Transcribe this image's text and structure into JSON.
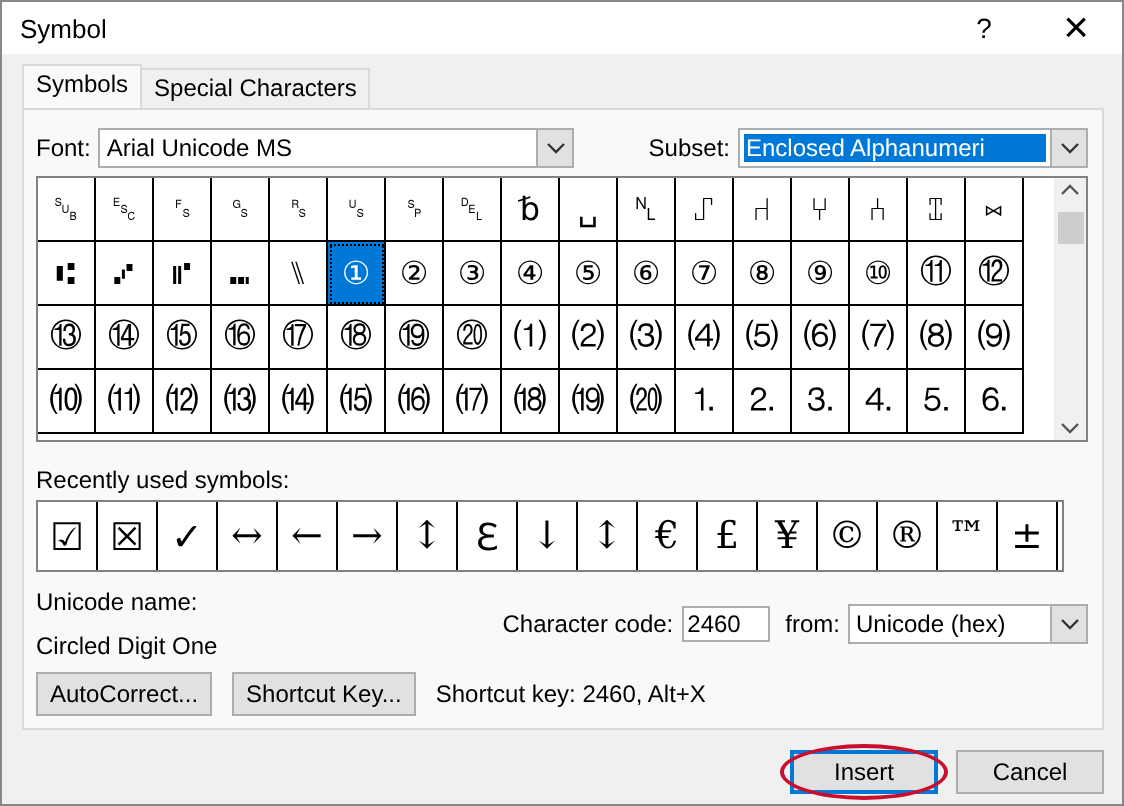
{
  "window": {
    "title": "Symbol",
    "help": "?",
    "close": "×"
  },
  "tabs": [
    {
      "label": "Symbols",
      "selected": true
    },
    {
      "label": "Special Characters",
      "selected": false
    }
  ],
  "font": {
    "label": "Font:",
    "value": "Arial Unicode MS"
  },
  "subset": {
    "label": "Subset:",
    "value": "Enclosed Alphanumeri"
  },
  "symbols": [
    [
      {
        "symbol": "␚",
        "selected": false
      },
      {
        "symbol": "␛",
        "selected": false
      },
      {
        "symbol": "␜",
        "selected": false
      },
      {
        "symbol": "␝",
        "selected": false
      },
      {
        "symbol": "␞",
        "selected": false
      },
      {
        "symbol": "␟",
        "selected": false
      },
      {
        "symbol": "␠",
        "selected": false
      },
      {
        "symbol": "␡",
        "selected": false
      },
      {
        "symbol": "␢",
        "selected": false
      },
      {
        "symbol": "␣",
        "selected": false
      },
      {
        "symbol": "␤",
        "selected": false
      },
      {
        "symbol": "⑀",
        "selected": false
      },
      {
        "symbol": "⑁",
        "selected": false
      },
      {
        "symbol": "⑂",
        "selected": false
      },
      {
        "symbol": "⑃",
        "selected": false
      },
      {
        "symbol": "⑄",
        "selected": false
      },
      {
        "symbol": "⑅",
        "selected": false
      }
    ],
    [
      {
        "symbol": "⑆",
        "selected": false
      },
      {
        "symbol": "⑇",
        "selected": false
      },
      {
        "symbol": "⑈",
        "selected": false
      },
      {
        "symbol": "⑉",
        "selected": false
      },
      {
        "symbol": "⑊",
        "selected": false
      },
      {
        "symbol": "①",
        "selected": true
      },
      {
        "symbol": "②",
        "selected": false
      },
      {
        "symbol": "③",
        "selected": false
      },
      {
        "symbol": "④",
        "selected": false
      },
      {
        "symbol": "⑤",
        "selected": false
      },
      {
        "symbol": "⑥",
        "selected": false
      },
      {
        "symbol": "⑦",
        "selected": false
      },
      {
        "symbol": "⑧",
        "selected": false
      },
      {
        "symbol": "⑨",
        "selected": false
      },
      {
        "symbol": "⑩",
        "selected": false
      },
      {
        "symbol": "⑪",
        "selected": false
      },
      {
        "symbol": "⑫",
        "selected": false
      }
    ],
    [
      {
        "symbol": "⑬",
        "selected": false
      },
      {
        "symbol": "⑭",
        "selected": false
      },
      {
        "symbol": "⑮",
        "selected": false
      },
      {
        "symbol": "⑯",
        "selected": false
      },
      {
        "symbol": "⑰",
        "selected": false
      },
      {
        "symbol": "⑱",
        "selected": false
      },
      {
        "symbol": "⑲",
        "selected": false
      },
      {
        "symbol": "⑳",
        "selected": false
      },
      {
        "symbol": "⑴",
        "selected": false
      },
      {
        "symbol": "⑵",
        "selected": false
      },
      {
        "symbol": "⑶",
        "selected": false
      },
      {
        "symbol": "⑷",
        "selected": false
      },
      {
        "symbol": "⑸",
        "selected": false
      },
      {
        "symbol": "⑹",
        "selected": false
      },
      {
        "symbol": "⑺",
        "selected": false
      },
      {
        "symbol": "⑻",
        "selected": false
      },
      {
        "symbol": "⑼",
        "selected": false
      }
    ],
    [
      {
        "symbol": "⑽",
        "selected": false
      },
      {
        "symbol": "⑾",
        "selected": false
      },
      {
        "symbol": "⑿",
        "selected": false
      },
      {
        "symbol": "⒀",
        "selected": false
      },
      {
        "symbol": "⒁",
        "selected": false
      },
      {
        "symbol": "⒂",
        "selected": false
      },
      {
        "symbol": "⒃",
        "selected": false
      },
      {
        "symbol": "⒄",
        "selected": false
      },
      {
        "symbol": "⒅",
        "selected": false
      },
      {
        "symbol": "⒆",
        "selected": false
      },
      {
        "symbol": "⒇",
        "selected": false
      },
      {
        "symbol": "⒈",
        "selected": false
      },
      {
        "symbol": "⒉",
        "selected": false
      },
      {
        "symbol": "⒊",
        "selected": false
      },
      {
        "symbol": "⒋",
        "selected": false
      },
      {
        "symbol": "⒌",
        "selected": false
      },
      {
        "symbol": "⒍",
        "selected": false
      }
    ]
  ],
  "recent": {
    "label": "Recently used symbols:",
    "symbols": [
      "☑",
      "☒",
      "✓",
      "↔",
      "←",
      "→",
      "↕",
      "ℇ",
      "↓",
      "↕",
      "€",
      "£",
      "¥",
      "©",
      "®",
      "™",
      "±"
    ]
  },
  "unicode_name": {
    "label": "Unicode name:",
    "value": "Circled Digit One"
  },
  "character_code": {
    "label": "Character code:",
    "value": "2460"
  },
  "from": {
    "label": "from:",
    "value": "Unicode (hex)"
  },
  "buttons": [
    {
      "label": "AutoCorrect..."
    },
    {
      "label": "Shortcut Key..."
    }
  ],
  "shortcut_text": "Shortcut key: 2460, Alt+X",
  "footer": [
    {
      "label": "Insert",
      "highlighted": true
    },
    {
      "label": "Cancel",
      "highlighted": false
    }
  ]
}
